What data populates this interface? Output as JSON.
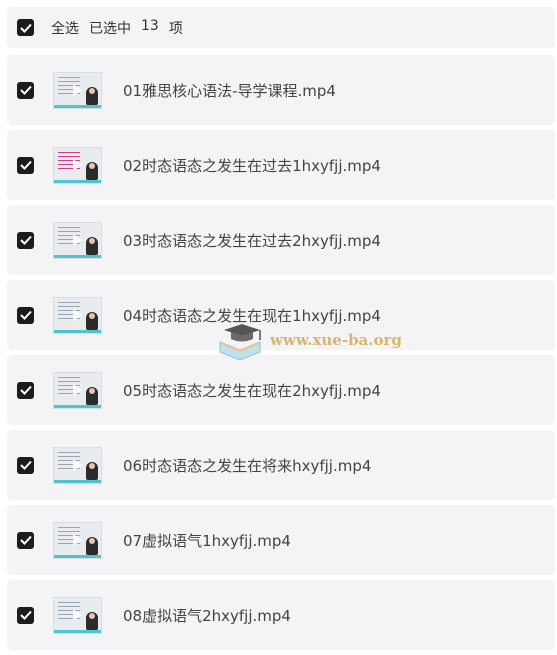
{
  "header": {
    "select_all_label": "全选",
    "selected_label": "已选中",
    "selected_count": "13",
    "count_unit": "项"
  },
  "files": [
    {
      "name": "01雅思核心语法-导学课程.mp4",
      "thumb": "default",
      "checked": true
    },
    {
      "name": "02时态语态之发生在过去1hxyfjj.mp4",
      "thumb": "pink",
      "checked": true
    },
    {
      "name": "03时态语态之发生在过去2hxyfjj.mp4",
      "thumb": "default",
      "checked": true
    },
    {
      "name": "04时态语态之发生在现在1hxyfjj.mp4",
      "thumb": "default",
      "checked": true
    },
    {
      "name": "05时态语态之发生在现在2hxyfjj.mp4",
      "thumb": "default",
      "checked": true
    },
    {
      "name": "06时态语态之发生在将来hxyfjj.mp4",
      "thumb": "default",
      "checked": true
    },
    {
      "name": "07虚拟语气1hxyfjj.mp4",
      "thumb": "default",
      "checked": true
    },
    {
      "name": "08虚拟语气2hxyfjj.mp4",
      "thumb": "default",
      "checked": true
    }
  ],
  "watermark": {
    "text": "www.xue-ba.org"
  },
  "colors": {
    "row_bg": "#f4f4f6",
    "checkbox": "#1c1c1e",
    "watermark": "#d9b46f"
  }
}
